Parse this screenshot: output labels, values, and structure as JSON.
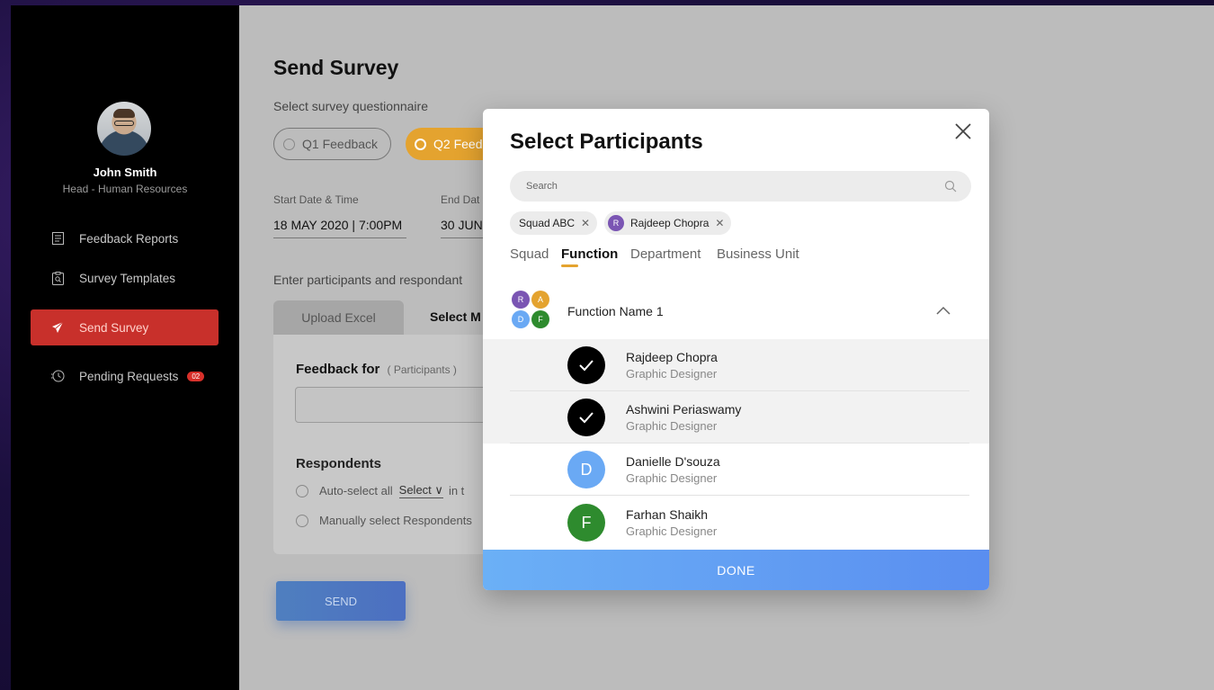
{
  "sidebar": {
    "user_name": "John Smith",
    "user_role": "Head - Human Resources",
    "items": [
      {
        "label": "Feedback Reports",
        "icon": "report-icon"
      },
      {
        "label": "Survey Templates",
        "icon": "clipboard-search-icon"
      },
      {
        "label": "Send Survey",
        "icon": "send-icon",
        "active": true
      },
      {
        "label": "Pending Requests",
        "icon": "clock-icon",
        "badge": "02"
      }
    ]
  },
  "main": {
    "title": "Send Survey",
    "questionnaire_label": "Select survey questionnaire",
    "questionnaire_options": [
      "Q1 Feedback",
      "Q2 Feed"
    ],
    "start_label": "Start Date & Time",
    "start_value": "18 MAY 2020 | 7:00PM",
    "end_label": "End Dat",
    "end_value": "30 JUN",
    "participants_label": "Enter participants and respondant",
    "tab_upload": "Upload Excel",
    "tab_select": "Select M",
    "feedback_for": "Feedback for",
    "feedback_for_sub": "( Participants )",
    "respondents": "Respondents",
    "auto_select": "Auto-select all",
    "auto_select_value": "Select",
    "auto_select_rest": "in t",
    "manual_select": "Manually select Respondents",
    "send": "SEND"
  },
  "modal": {
    "title": "Select Participants",
    "search_placeholder": "Search",
    "chips": [
      {
        "label": "Squad ABC"
      },
      {
        "label": "Rajdeep Chopra",
        "initial": "R"
      }
    ],
    "tabs": [
      "Squad",
      "Function",
      "Department",
      "Business Unit"
    ],
    "active_tab": "Function",
    "group": {
      "name": "Function Name 1",
      "avatars": [
        "R",
        "A",
        "D",
        "F"
      ]
    },
    "people": [
      {
        "name": "Rajdeep Chopra",
        "role": "Graphic Designer",
        "checked": true
      },
      {
        "name": "Ashwini Periaswamy",
        "role": "Graphic Designer",
        "checked": true
      },
      {
        "name": "Danielle D'souza",
        "role": "Graphic Designer",
        "initial": "D",
        "color": "#6aa9f4",
        "checked": false
      },
      {
        "name": "Farhan Shaikh",
        "role": "Graphic Designer",
        "initial": "F",
        "color": "#2e8b2e",
        "checked": false
      }
    ],
    "done": "DONE"
  },
  "colors": {
    "accent_orange": "#e4a32f",
    "active_red": "#c8302b",
    "done_blue": "#6bb0f6"
  }
}
